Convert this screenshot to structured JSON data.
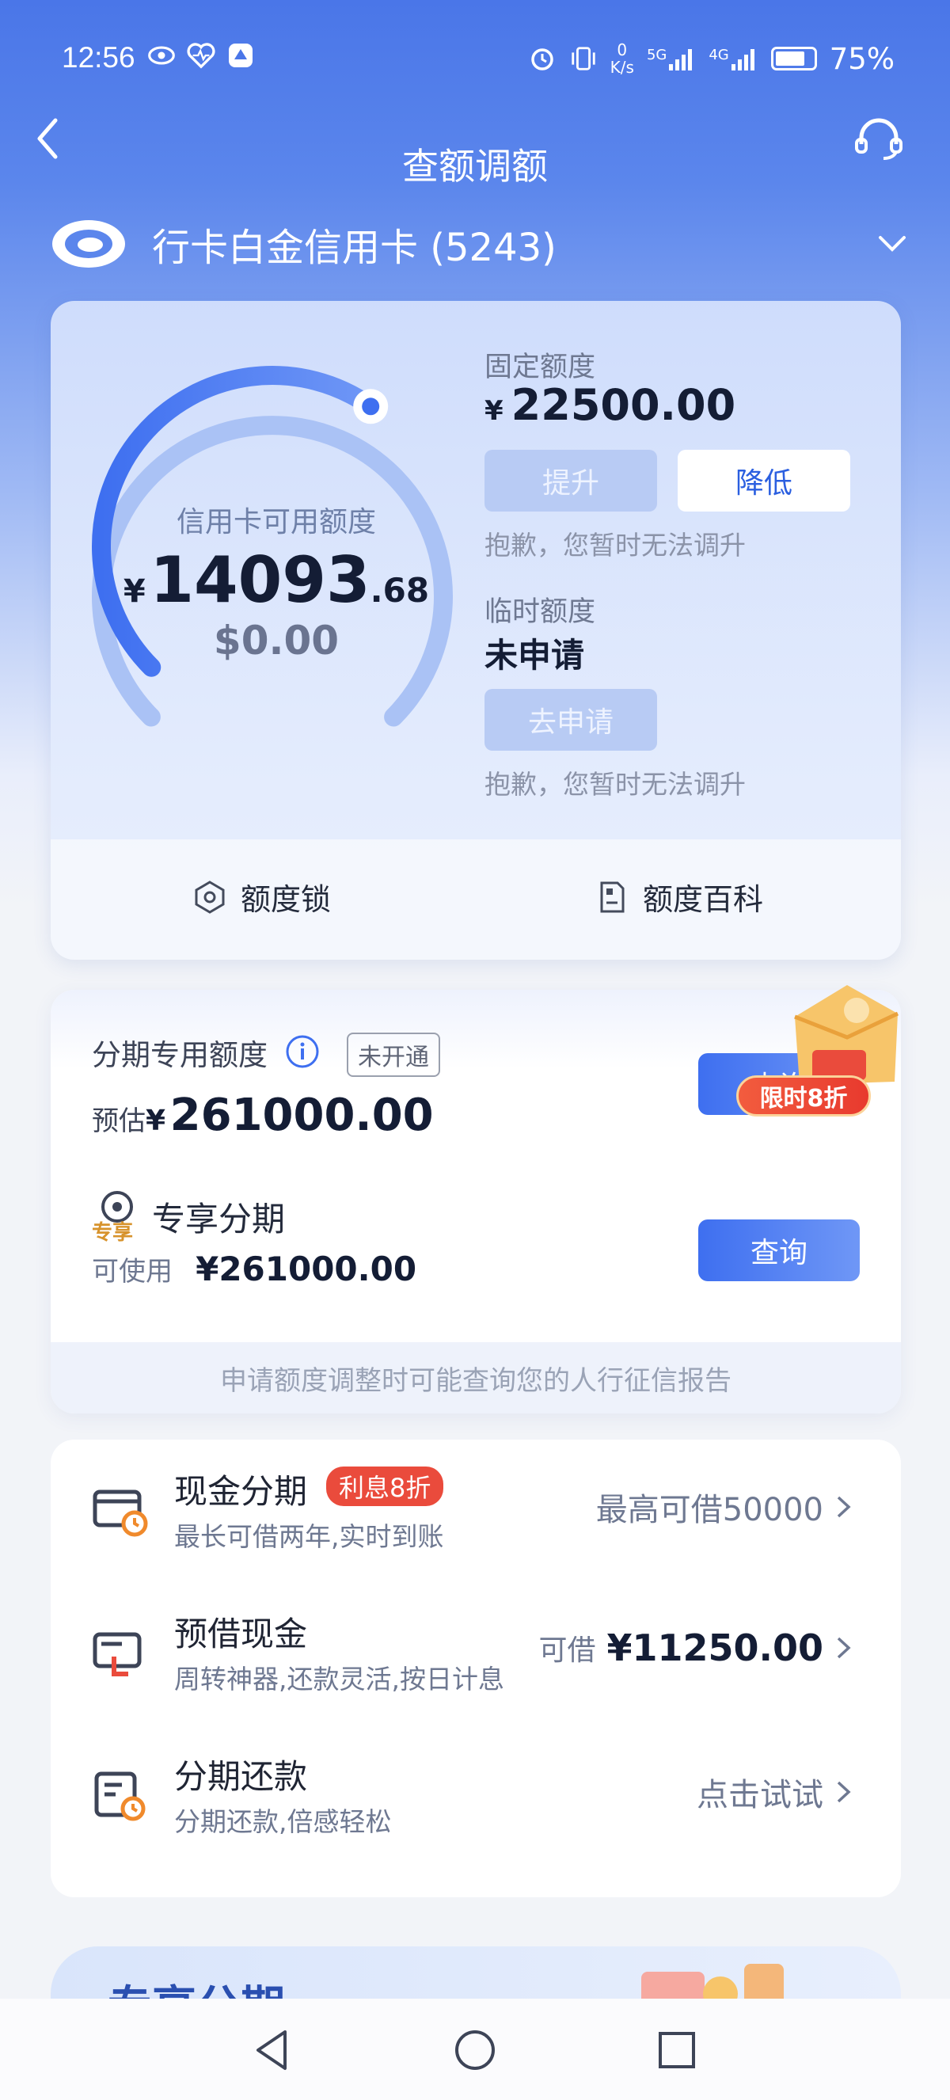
{
  "status_bar": {
    "time": "12:56",
    "net_speed_value": "0",
    "net_speed_unit": "K/s",
    "signal_1": "5G",
    "signal_2": "4G",
    "battery": "75%",
    "icons": [
      "eye-icon",
      "heart-pulse-icon",
      "app-icon",
      "alarm-icon",
      "vibrate-icon",
      "signal-icon",
      "battery-icon"
    ]
  },
  "header": {
    "title": "查额调额",
    "back_icon": "back-arrow-icon",
    "service_icon": "headset-icon"
  },
  "card_selector": {
    "name": "行卡白金信用卡 (5243)",
    "logo": "bank-logo-icon",
    "dropdown_icon": "chevron-down-icon"
  },
  "quota": {
    "available_label": "信用卡可用额度",
    "currency": "¥",
    "available_int": "14093",
    "available_dec": ".68",
    "available_usd": "$0.00",
    "gauge_fraction": 0.63,
    "fixed_label": "固定额度",
    "fixed_amount": "22500.00",
    "raise_button": "提升",
    "lower_button": "降低",
    "sorry_text_1": "抱歉，您暂时无法调升",
    "temp_label": "临时额度",
    "temp_value": "未申请",
    "apply_button": "去申请",
    "sorry_text_2": "抱歉，您暂时无法调升",
    "footer": {
      "lock_label": "额度锁",
      "wiki_label": "额度百科"
    }
  },
  "installment": {
    "title": "分期专用额度",
    "status_tag": "未开通",
    "estimate_prefix": "预估",
    "estimate_currency": "¥",
    "estimate_amount": "261000.00",
    "query_button_1": "查询",
    "promo_tag": "限时8折",
    "exclusive_badge": "专享",
    "exclusive_title": "专享分期",
    "usable_prefix": "可使用",
    "usable_amount": "¥261000.00",
    "query_button_2": "查询",
    "note": "申请额度调整时可能查询您的人行征信报告"
  },
  "services": [
    {
      "title": "现金分期",
      "tag": "利息8折",
      "subtitle": "最长可借两年,实时到账",
      "right_text": "最高可借50000",
      "icon": "cash-installment-icon"
    },
    {
      "title": "预借现金",
      "subtitle": "周转神器,还款灵活,按日计息",
      "right_prefix": "可借",
      "right_amount": "¥11250.00",
      "icon": "cash-advance-icon"
    },
    {
      "title": "分期还款",
      "subtitle": "分期还款,倍感轻松",
      "right_text": "点击试试",
      "icon": "repayment-installment-icon"
    }
  ],
  "peek_banner": {
    "title": "专享分期"
  },
  "colors": {
    "primary": "#3e6ff0",
    "header_bg": "#4a76e8",
    "promo_red": "#ea4b3c",
    "text_dark": "#141d35"
  }
}
